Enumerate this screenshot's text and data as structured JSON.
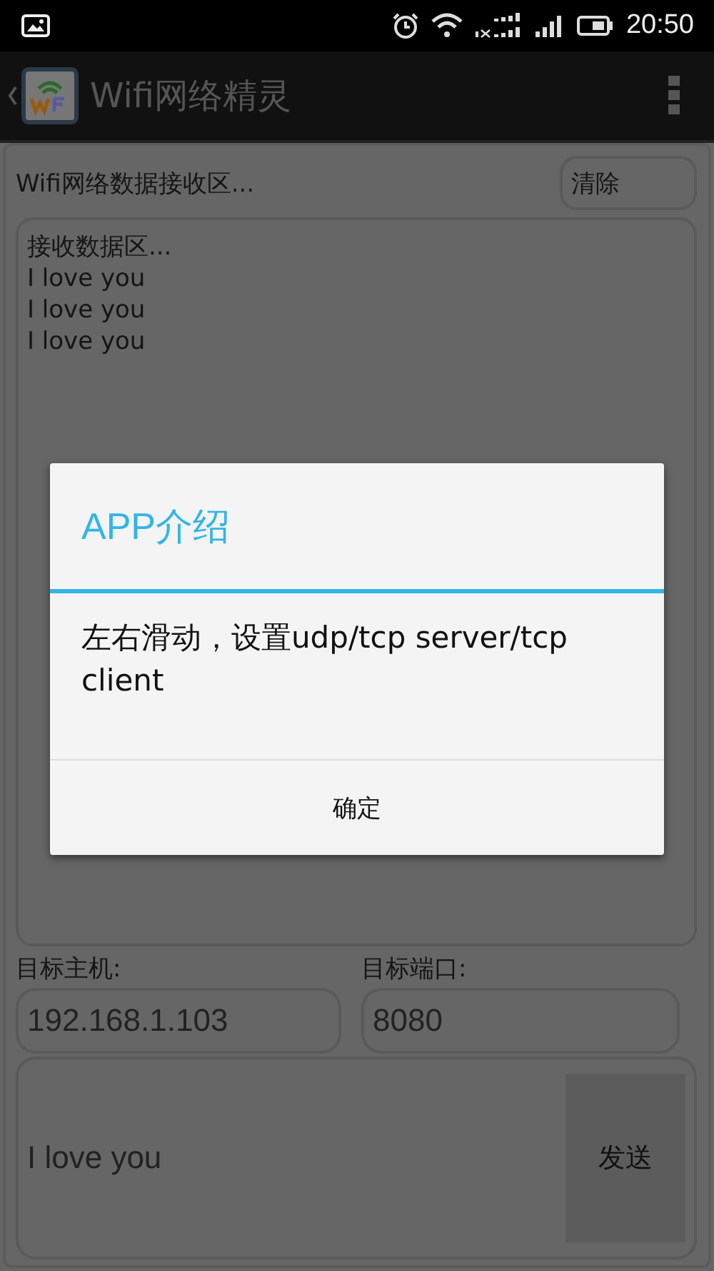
{
  "status_bar": {
    "time": "20:50"
  },
  "action_bar": {
    "title": "Wifi网络精灵"
  },
  "receive": {
    "title": "Wifi网络数据接收区...",
    "clear_button": "清除",
    "lines": [
      "接收数据区...",
      "I love you",
      "I love you",
      "I love you"
    ]
  },
  "target": {
    "host_label": "目标主机:",
    "host_value": "192.168.1.103",
    "port_label": "目标端口:",
    "port_value": "8080"
  },
  "send": {
    "message": "I love you",
    "button": "发送"
  },
  "dialog": {
    "title": "APP介绍",
    "message": "左右滑动，设置udp/tcp server/tcp client",
    "button": "确定"
  }
}
